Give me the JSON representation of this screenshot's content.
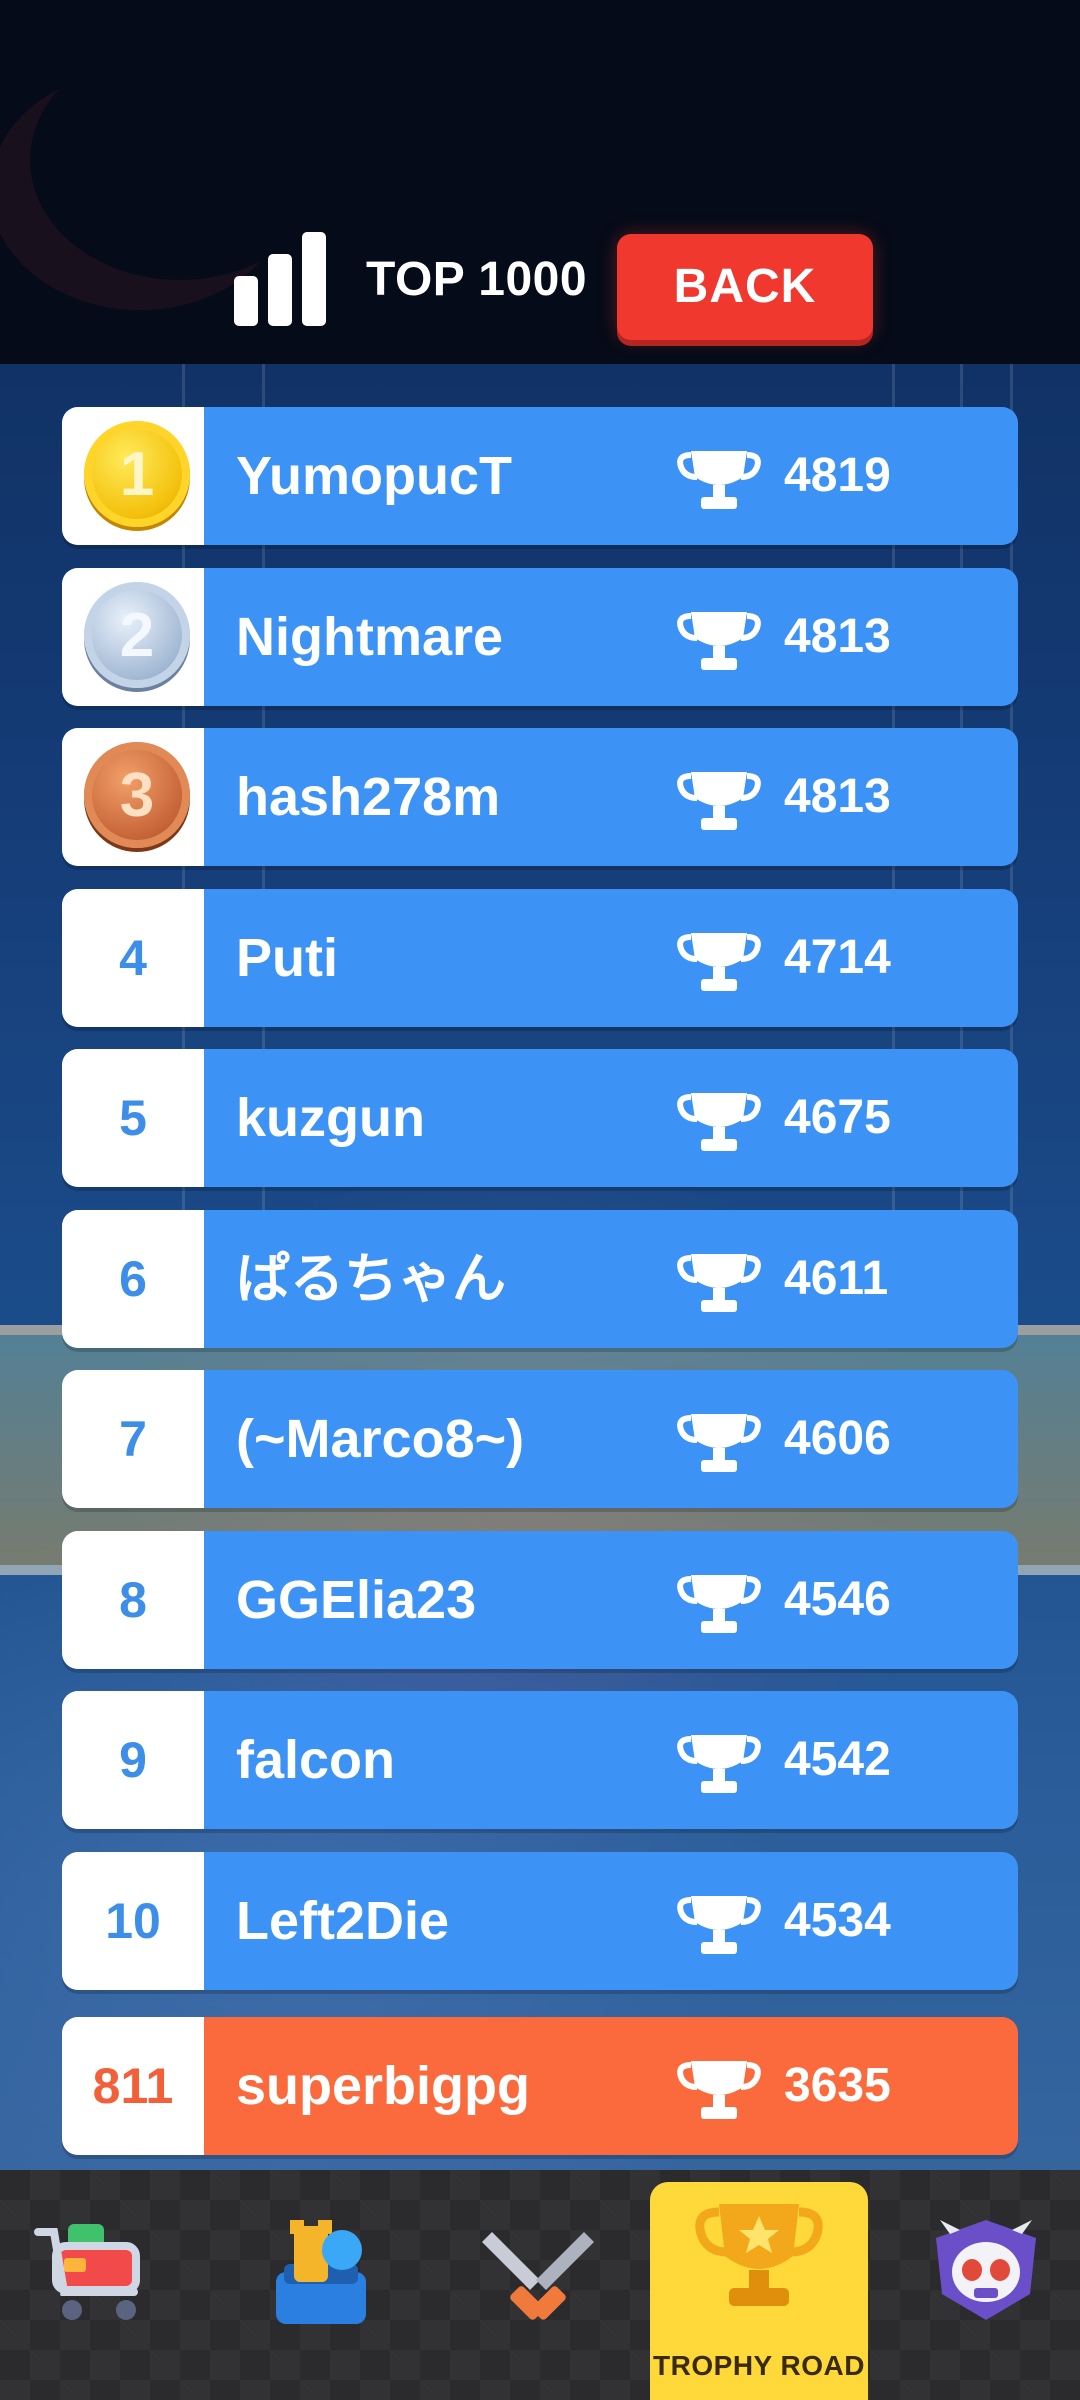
{
  "header": {
    "top_label": "TOP 1000",
    "back_label": "BACK"
  },
  "leaderboard": [
    {
      "rank": "1",
      "medal": "gold",
      "name": "YumopucT",
      "trophies": "4819"
    },
    {
      "rank": "2",
      "medal": "silver",
      "name": "Nightmare",
      "trophies": "4813"
    },
    {
      "rank": "3",
      "medal": "bronze",
      "name": "hash278m",
      "trophies": "4813"
    },
    {
      "rank": "4",
      "medal": "",
      "name": "Puti",
      "trophies": "4714"
    },
    {
      "rank": "5",
      "medal": "",
      "name": "kuzgun",
      "trophies": "4675"
    },
    {
      "rank": "6",
      "medal": "",
      "name": "ぱるちゃん",
      "trophies": "4611"
    },
    {
      "rank": "7",
      "medal": "",
      "name": "(~Marco8~)",
      "trophies": "4606"
    },
    {
      "rank": "8",
      "medal": "",
      "name": "GGElia23",
      "trophies": "4546"
    },
    {
      "rank": "9",
      "medal": "",
      "name": "falcon",
      "trophies": "4542"
    },
    {
      "rank": "10",
      "medal": "",
      "name": "Left2Die",
      "trophies": "4534"
    }
  ],
  "current_player": {
    "rank": "811",
    "name": "superbigpg",
    "trophies": "3635"
  },
  "nav": {
    "items": [
      {
        "icon": "shop-cart-icon"
      },
      {
        "icon": "collection-icon"
      },
      {
        "icon": "battle-swords-icon"
      },
      {
        "icon": "trophy-icon",
        "label": "TROPHY ROAD",
        "active": true
      },
      {
        "icon": "skull-club-icon"
      }
    ]
  },
  "colors": {
    "row_blue": "#3d93f5",
    "row_me": "#fb6a3c",
    "back_red": "#f0382f",
    "nav_active": "#ffd83a"
  }
}
